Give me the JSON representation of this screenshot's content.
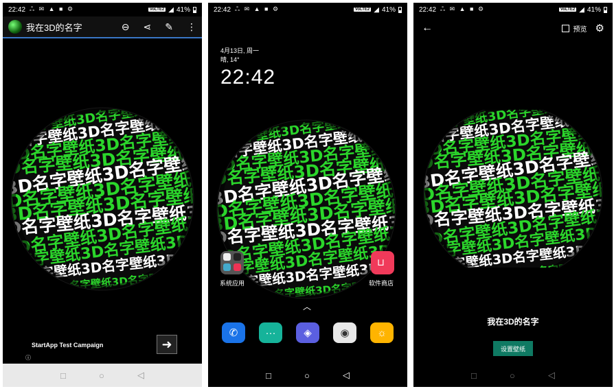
{
  "status": {
    "time": "22:42",
    "battery": "41%",
    "volte": "VoLTE2"
  },
  "screen1": {
    "title": "我在3D的名字",
    "ad_text": "StartApp Test Campaign",
    "ad_arrow": "➜",
    "ad_info": "ⓘ"
  },
  "screen2": {
    "date": "4月13日, 周一",
    "weather": "晴, 14°",
    "clock": "22:42",
    "folder_label": "系统应用",
    "store_label": "软件商店"
  },
  "screen3": {
    "preview_label": "预览",
    "wallpaper_name": "我在3D的名字",
    "set_button": "设置壁纸"
  },
  "sphere_text": "3D名字壁纸",
  "colors": {
    "green": "#2bd62b",
    "white": "#ffffff",
    "teal_button": "#0f7a63"
  }
}
